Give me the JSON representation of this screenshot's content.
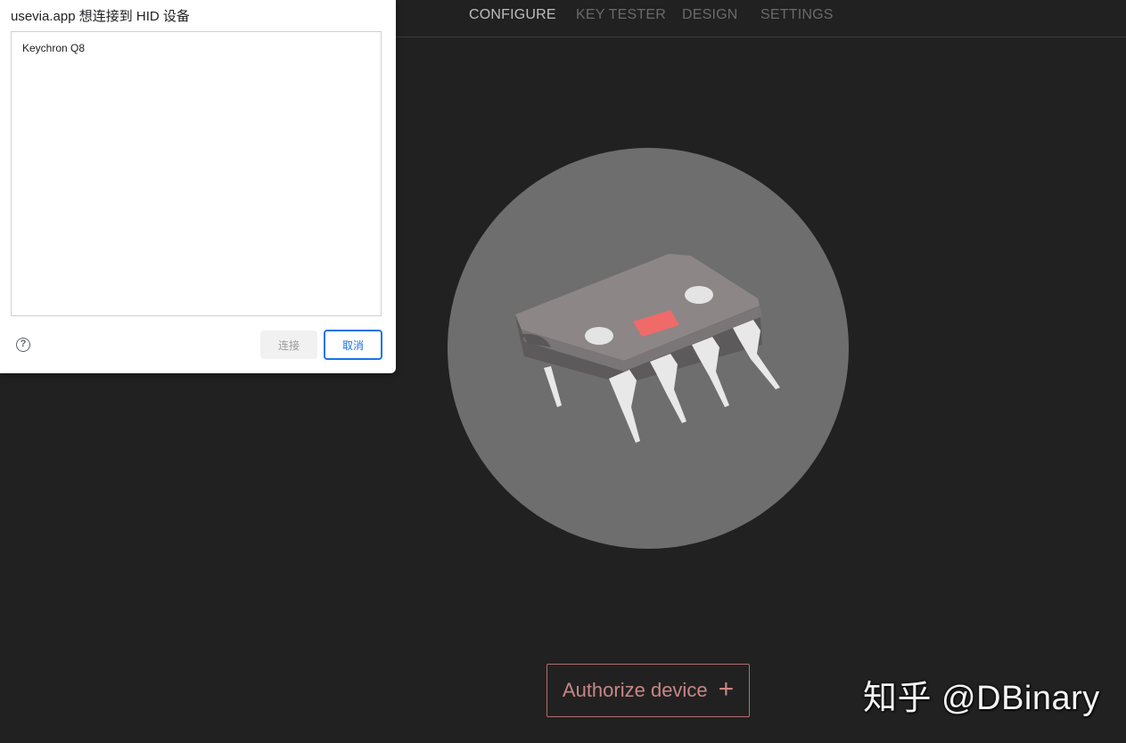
{
  "nav": {
    "items": [
      {
        "label": "CONFIGURE",
        "active": true
      },
      {
        "label": "KEY TESTER",
        "active": false
      },
      {
        "label": "DESIGN",
        "active": false
      },
      {
        "label": "SETTINGS",
        "active": false
      }
    ]
  },
  "illustration": {
    "icon": "ic-chip-icon",
    "circle_color": "#6e6e6e",
    "chip_color": "#8c8687",
    "led_color": "#f06a6a"
  },
  "authorize": {
    "label": "Authorize device",
    "icon_glyph": "+",
    "color": "#c98686"
  },
  "dialog": {
    "title": "usevia.app 想连接到 HID 设备",
    "devices": [
      "Keychron Q8"
    ],
    "help_glyph": "?",
    "connect_label": "连接",
    "cancel_label": "取消"
  },
  "watermark": {
    "text": "知乎 @DBinary"
  }
}
